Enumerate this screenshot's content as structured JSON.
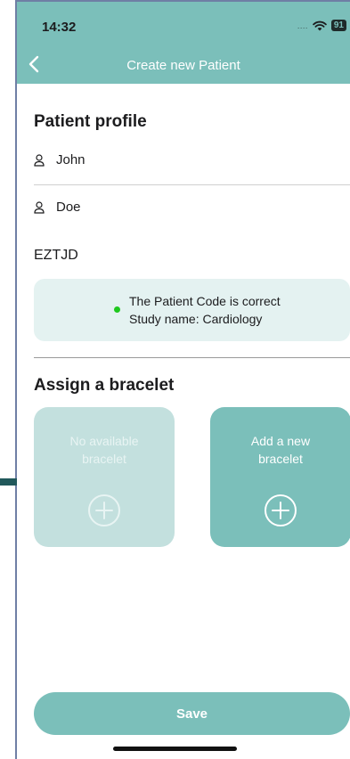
{
  "status_bar": {
    "time": "14:32",
    "signal": "....",
    "battery": "91",
    "wifi_icon": "wifi-icon"
  },
  "header": {
    "title": "Create new Patient",
    "back_icon": "chevron-left-icon"
  },
  "profile": {
    "section_title": "Patient profile",
    "first_name": "John",
    "last_name": "Doe",
    "patient_code": "EZTJD",
    "person_icon": "person-icon",
    "validation": {
      "line1": "The Patient Code is correct",
      "line2": "Study name: Cardiology",
      "status_color": "#1fc81f"
    }
  },
  "bracelet": {
    "section_title": "Assign a bracelet",
    "cards": [
      {
        "label": "No available bracelet",
        "enabled": false,
        "icon": "plus-circle-icon"
      },
      {
        "label": "Add a new bracelet",
        "enabled": true,
        "icon": "plus-circle-icon"
      }
    ]
  },
  "footer": {
    "save_label": "Save"
  },
  "colors": {
    "accent": "#7bbfba",
    "accent_light": "#c3e0de",
    "info_box": "#e4f2f1",
    "side_marker": "#21585b"
  }
}
